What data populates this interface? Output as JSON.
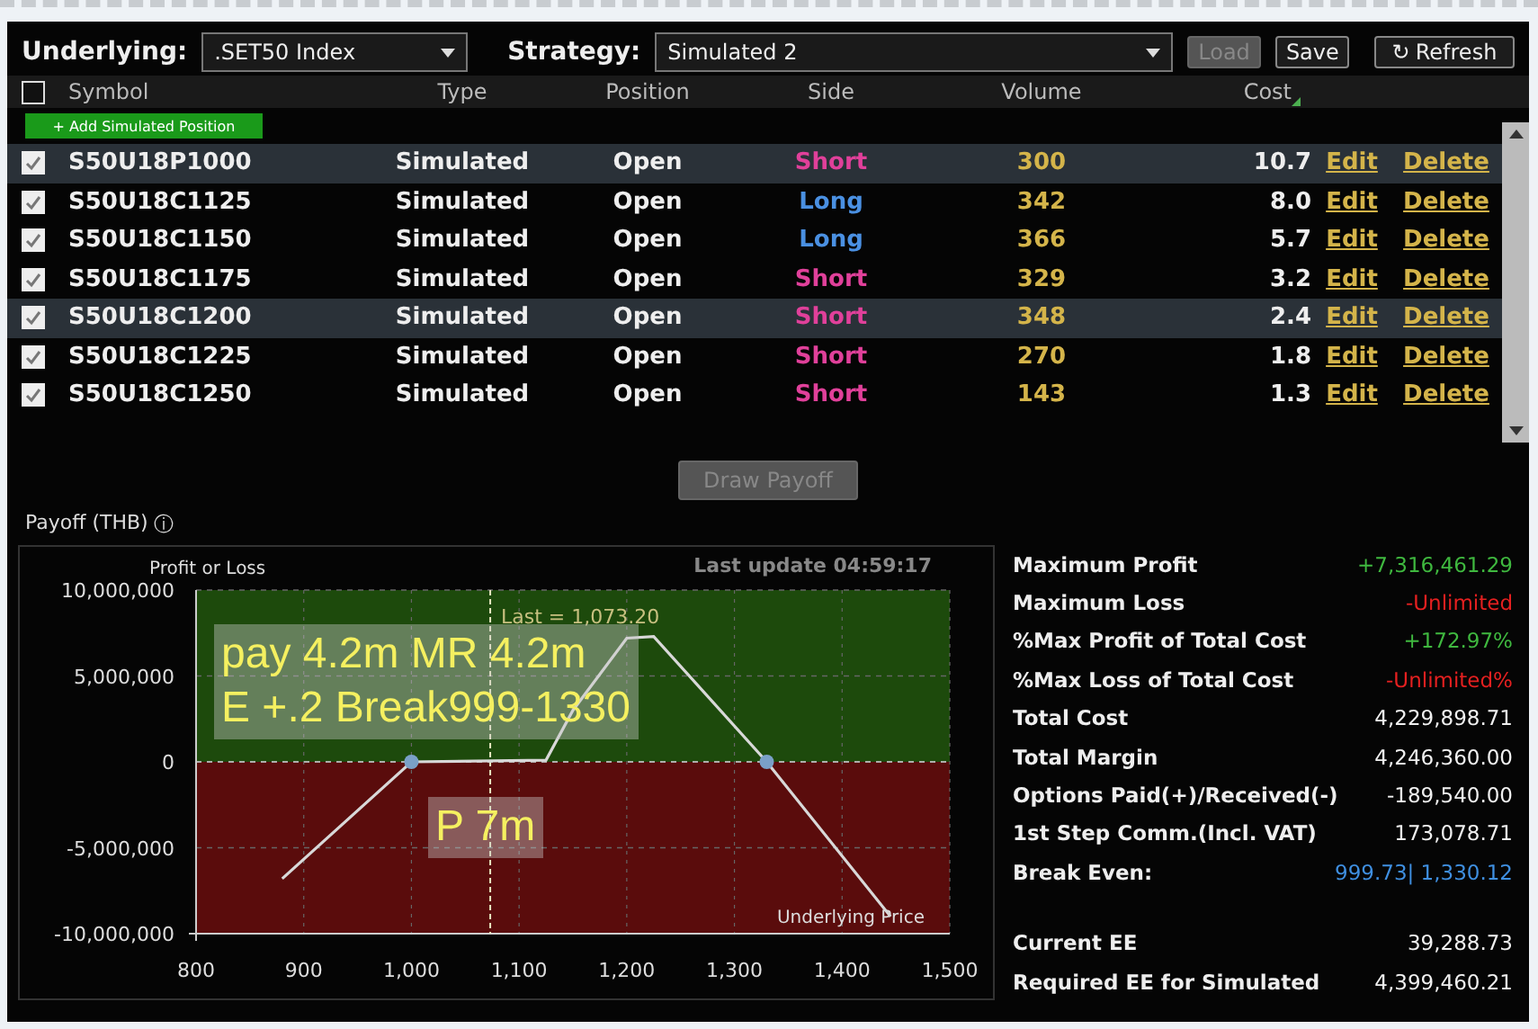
{
  "toolbar": {
    "underlying_label": "Underlying:",
    "underlying_value": ".SET50 Index",
    "strategy_label": "Strategy:",
    "strategy_value": "Simulated 2",
    "buttons": [
      {
        "label": "Load",
        "disabled": true
      },
      {
        "label": "Save",
        "disabled": false
      }
    ],
    "refresh": {
      "icon": "↻",
      "label": "Refresh"
    }
  },
  "table": {
    "select_all": {
      "checked": false
    },
    "columns": [
      {
        "label": "Symbol",
        "sorted": false
      },
      {
        "label": "Type",
        "sorted": false
      },
      {
        "label": "Position",
        "sorted": false
      },
      {
        "label": "Side",
        "sorted": false
      },
      {
        "label": "Volume",
        "sorted": false
      },
      {
        "label": "Cost",
        "sorted": true
      }
    ],
    "add_button": "+ Add Simulated Position",
    "rows": [
      {
        "checked": true,
        "selected": true,
        "symbol": "S50U18P1000",
        "type": "Simulated",
        "position": "Open",
        "side": "Short",
        "color": "#e0409a",
        "volume": "300",
        "cost": "10.7",
        "edit": "Edit",
        "delete": "Delete"
      },
      {
        "checked": true,
        "selected": false,
        "symbol": "S50U18C1125",
        "type": "Simulated",
        "position": "Open",
        "side": "Long",
        "color": "#4a90e2",
        "volume": "342",
        "cost": "8.0",
        "edit": "Edit",
        "delete": "Delete"
      },
      {
        "checked": true,
        "selected": false,
        "symbol": "S50U18C1150",
        "type": "Simulated",
        "position": "Open",
        "side": "Long",
        "color": "#4a90e2",
        "volume": "366",
        "cost": "5.7",
        "edit": "Edit",
        "delete": "Delete"
      },
      {
        "checked": true,
        "selected": false,
        "symbol": "S50U18C1175",
        "type": "Simulated",
        "position": "Open",
        "side": "Short",
        "color": "#e0409a",
        "volume": "329",
        "cost": "3.2",
        "edit": "Edit",
        "delete": "Delete"
      },
      {
        "checked": true,
        "selected": true,
        "symbol": "S50U18C1200",
        "type": "Simulated",
        "position": "Open",
        "side": "Short",
        "color": "#e0409a",
        "volume": "348",
        "cost": "2.4",
        "edit": "Edit",
        "delete": "Delete"
      },
      {
        "checked": true,
        "selected": false,
        "symbol": "S50U18C1225",
        "type": "Simulated",
        "position": "Open",
        "side": "Short",
        "color": "#e0409a",
        "volume": "270",
        "cost": "1.8",
        "edit": "Edit",
        "delete": "Delete"
      },
      {
        "checked": true,
        "selected": false,
        "symbol": "S50U18C1250",
        "type": "Simulated",
        "position": "Open",
        "side": "Short",
        "color": "#e0409a",
        "volume": "143",
        "cost": "1.3",
        "edit": "Edit",
        "delete": "Delete"
      }
    ]
  },
  "draw_button": {
    "label": "Draw Payoff",
    "disabled": true
  },
  "payoff": {
    "title": "Payoff (THB)",
    "info_icon": "ⓘ",
    "last_update": "Last update 04:59:17",
    "chart_data": {
      "type": "line",
      "xlabel": "Underlying Price",
      "ylabel": "Profit or Loss",
      "x": [
        880,
        1000,
        1125,
        1150,
        1200,
        1225,
        1330,
        1445
      ],
      "series": [
        {
          "color": "#d8d8d8",
          "values": [
            -6800000,
            0,
            100000,
            3000000,
            7200000,
            7300000,
            0,
            -9000000
          ]
        }
      ],
      "xlim": [
        800,
        1500
      ],
      "ylim": [
        -10000000,
        10000000
      ],
      "xticks": [
        {
          "value": 800,
          "label": "800"
        },
        {
          "value": 900,
          "label": "900"
        },
        {
          "value": 1000,
          "label": "1,000"
        },
        {
          "value": 1100,
          "label": "1,100"
        },
        {
          "value": 1200,
          "label": "1,200"
        },
        {
          "value": 1300,
          "label": "1,300"
        },
        {
          "value": 1400,
          "label": "1,400"
        },
        {
          "value": 1500,
          "label": "1,500"
        }
      ],
      "yticks": [
        {
          "value": 10000000,
          "label": "10,000,000"
        },
        {
          "value": 5000000,
          "label": "5,000,000"
        },
        {
          "value": 0,
          "label": "0"
        },
        {
          "value": -5000000,
          "label": "-5,000,000"
        },
        {
          "value": -10000000,
          "label": "-10,000,000"
        }
      ],
      "grid": true,
      "ref_lines": [
        {
          "axis": "x",
          "value": 1073.2,
          "color": "#e8e8c0"
        },
        {
          "axis": "y",
          "value": 0,
          "color": "#cccccc"
        }
      ],
      "annotations": [
        {
          "text": "Last = 1,073.20",
          "x": 1073.2,
          "y": 8500000
        }
      ]
    },
    "notes": [
      {
        "lines": [
          "pay 4.2m MR 4.2m",
          "E +.2 Break999-1330"
        ]
      },
      {
        "lines": [
          "P 7m"
        ]
      }
    ]
  },
  "stats": [
    {
      "label": "Maximum Profit",
      "value": "+7,316,461.29",
      "color": "#3fb83f"
    },
    {
      "label": "Maximum Loss",
      "value": "-Unlimited",
      "color": "#e52020"
    },
    {
      "label": "%Max Profit of Total Cost",
      "value": "+172.97%",
      "color": "#3fb83f"
    },
    {
      "label": "%Max Loss of Total Cost",
      "value": "-Unlimited%",
      "color": "#e52020"
    },
    {
      "label": "Total Cost",
      "value": "4,229,898.71",
      "color": "#f0f0f0"
    },
    {
      "label": "Total Margin",
      "value": "4,246,360.00",
      "color": "#f0f0f0"
    },
    {
      "label": "Options Paid(+)/Received(-)",
      "value": "-189,540.00",
      "color": "#f0f0f0"
    },
    {
      "label": "1st Step Comm.(Incl. VAT)",
      "value": "173,078.71",
      "color": "#f0f0f0"
    },
    {
      "label": "Break Even:",
      "value": "999.73| 1,330.12",
      "color": "#3f8fe0"
    }
  ],
  "ee_stats": [
    {
      "label": "Current EE",
      "value": "39,288.73",
      "color": "#f0f0f0"
    },
    {
      "label": "Required EE for Simulated",
      "value": "4,399,460.21",
      "color": "#f0f0f0"
    }
  ]
}
